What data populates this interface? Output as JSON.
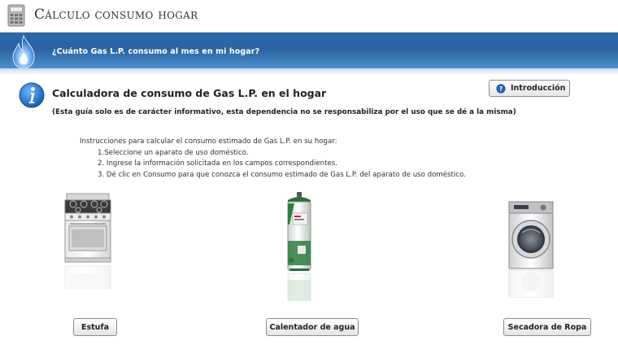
{
  "app": {
    "title": "Cálculo consumo hogar",
    "icon": "calculator-icon"
  },
  "banner": {
    "question": "¿Cuánto Gas L.P. consumo al mes en mi hogar?",
    "icon": "flame-icon"
  },
  "heading": {
    "title": "Calculadora de consumo de Gas L.P. en el hogar",
    "icon": "info-icon",
    "disclaimer": "(Esta guía solo es de carácter informativo, esta dependencia no se responsabiliza por el uso que se dé a la misma)"
  },
  "intro_button": {
    "label": "Introducción",
    "icon": "help-icon"
  },
  "instructions": {
    "title": "Instrucciones para calcular el consumo estimado de Gas L.P. en su hogar:",
    "steps": [
      "1.Seleccione un aparato de uso doméstico.",
      "2. Ingrese la información solicitada en los campos correspondientes.",
      "3. Dé clic en Consumo para que conozca el consumo estimado de Gas L.P. del aparato de uso doméstico."
    ]
  },
  "appliances": [
    {
      "label": "Estufa",
      "icon": "stove-image"
    },
    {
      "label": "Calentador de agua",
      "icon": "water-heater-image"
    },
    {
      "label": "Secadora de Ropa",
      "icon": "dryer-image"
    }
  ],
  "colors": {
    "banner_blue": "#2b6aa8",
    "info_blue": "#1f6fc4"
  }
}
